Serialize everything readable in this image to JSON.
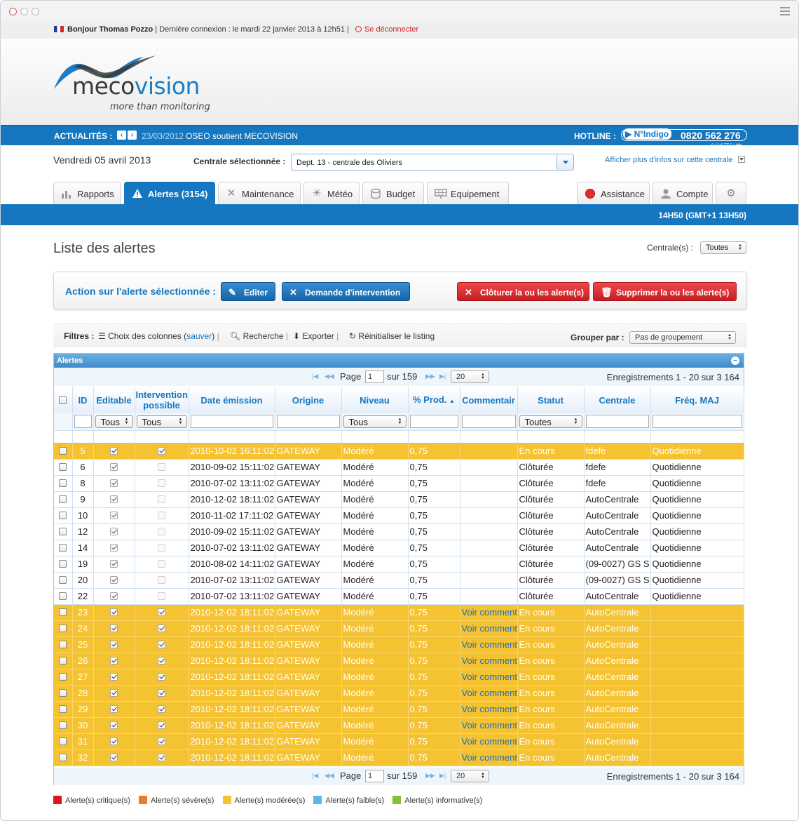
{
  "welcome": {
    "greeting": "Bonjour Thomas Pozzo",
    "last_login": " | Dernière connexion : le mardi 22 janvier 2013 à 12h51 | ",
    "logout": "Se déconnecter"
  },
  "brand": {
    "name_start": "meco",
    "name_end": "vision",
    "tagline": "more than monitoring"
  },
  "news": {
    "label": "ACTUALITÉS :",
    "date": "23/03/2012",
    "text": "OSEO soutient MECOVISION",
    "hotline_label": "HOTLINE :",
    "indigo_label": "N°Indigo",
    "indigo_number": "0820 562 276",
    "indigo_rate": "0,12 € TTC / MN"
  },
  "header": {
    "date": "Vendredi 05 avril 2013",
    "central_label": "Centrale sélectionnée :",
    "central_value": "Dept. 13 - centrale des Oliviers",
    "more_info": "Afficher plus d'infos sur cette centrale"
  },
  "tabs": [
    {
      "label": "Rapports",
      "icon": "bar-chart-icon"
    },
    {
      "label": "Alertes (3154)",
      "icon": "warning-icon"
    },
    {
      "label": "Maintenance",
      "icon": "wrench-icon"
    },
    {
      "label": "Météo",
      "icon": "sun-icon"
    },
    {
      "label": "Budget",
      "icon": "coins-icon"
    },
    {
      "label": "Equipement",
      "icon": "panel-icon"
    },
    {
      "label": "Assistance",
      "icon": "lifebuoy-icon"
    },
    {
      "label": "Compte",
      "icon": "user-icon"
    },
    {
      "label": "",
      "icon": "gear-icon"
    }
  ],
  "clock": "14H50 (GMT+1 13H50)",
  "page": {
    "title": "Liste des alertes",
    "central_filter_label": "Centrale(s) :",
    "central_filter_value": "Toutes"
  },
  "actions": {
    "label": "Action sur l'alerte sélectionnée :",
    "edit": "Editer",
    "intervention": "Demande d'intervention",
    "close": "Clôturer la ou les alerte(s)",
    "delete": "Supprimer la ou les alerte(s)"
  },
  "filters": {
    "label": "Filtres :",
    "columns": "Choix des colonnes",
    "save": "sauver",
    "search": "Recherche",
    "export": "Exporter",
    "reset": "Réinitialiser le listing",
    "group_label": "Grouper par :",
    "group_value": "Pas de groupement"
  },
  "grid": {
    "title": "Alertes",
    "page_label": "Page",
    "page_value": "1",
    "of_label": "sur 159",
    "page_size": "20",
    "records": "Enregistrements 1 - 20 sur 3 164",
    "columns": [
      "ID",
      "Editable",
      "Intervention possible",
      "Date émission",
      "Origine",
      "Niveau",
      "% Prod.",
      "Commentair",
      "Statut",
      "Centrale",
      "Fréq. MAJ"
    ],
    "filter_values": {
      "editable": "Tous",
      "intervention": "Tous",
      "niveau": "Tous",
      "statut": "Toutes"
    },
    "rows": [
      {
        "id": "5",
        "ed": true,
        "iv": true,
        "date": "2010-10-02 16:11:02",
        "origine": "GATEWAY",
        "niveau": "Modéré",
        "prod": "0,75",
        "comment": "",
        "statut": "En cours",
        "centrale": "fdefe",
        "freq": "Quotidienne",
        "hl": true
      },
      {
        "id": "6",
        "ed": true,
        "iv": false,
        "date": "2010-09-02 15:11:02",
        "origine": "GATEWAY",
        "niveau": "Modéré",
        "prod": "0,75",
        "comment": "",
        "statut": "Clôturée",
        "centrale": "fdefe",
        "freq": "Quotidienne",
        "hl": false
      },
      {
        "id": "8",
        "ed": true,
        "iv": false,
        "date": "2010-07-02 13:11:02",
        "origine": "GATEWAY",
        "niveau": "Modéré",
        "prod": "0,75",
        "comment": "",
        "statut": "Clôturée",
        "centrale": "fdefe",
        "freq": "Quotidienne",
        "hl": false
      },
      {
        "id": "9",
        "ed": true,
        "iv": false,
        "date": "2010-12-02 18:11:02",
        "origine": "GATEWAY",
        "niveau": "Modéré",
        "prod": "0,75",
        "comment": "",
        "statut": "Clôturée",
        "centrale": "AutoCentrale",
        "freq": "Quotidienne",
        "hl": false
      },
      {
        "id": "10",
        "ed": true,
        "iv": false,
        "date": "2010-11-02 17:11:02",
        "origine": "GATEWAY",
        "niveau": "Modéré",
        "prod": "0,75",
        "comment": "",
        "statut": "Clôturée",
        "centrale": "AutoCentrale",
        "freq": "Quotidienne",
        "hl": false
      },
      {
        "id": "12",
        "ed": true,
        "iv": false,
        "date": "2010-09-02 15:11:02",
        "origine": "GATEWAY",
        "niveau": "Modéré",
        "prod": "0,75",
        "comment": "",
        "statut": "Clôturée",
        "centrale": "AutoCentrale",
        "freq": "Quotidienne",
        "hl": false
      },
      {
        "id": "14",
        "ed": true,
        "iv": false,
        "date": "2010-07-02 13:11:02",
        "origine": "GATEWAY",
        "niveau": "Modéré",
        "prod": "0,75",
        "comment": "",
        "statut": "Clôturée",
        "centrale": "AutoCentrale",
        "freq": "Quotidienne",
        "hl": false
      },
      {
        "id": "19",
        "ed": true,
        "iv": false,
        "date": "2010-08-02 14:11:02",
        "origine": "GATEWAY",
        "niveau": "Modéré",
        "prod": "0,75",
        "comment": "",
        "statut": "Clôturée",
        "centrale": "(09-0027) GS S",
        "freq": "Quotidienne",
        "hl": false
      },
      {
        "id": "20",
        "ed": true,
        "iv": false,
        "date": "2010-07-02 13:11:02",
        "origine": "GATEWAY",
        "niveau": "Modéré",
        "prod": "0,75",
        "comment": "",
        "statut": "Clôturée",
        "centrale": "(09-0027) GS S",
        "freq": "Quotidienne",
        "hl": false
      },
      {
        "id": "22",
        "ed": true,
        "iv": false,
        "date": "2010-07-02 13:11:02",
        "origine": "GATEWAY",
        "niveau": "Modéré",
        "prod": "0,75",
        "comment": "",
        "statut": "Clôturée",
        "centrale": "AutoCentrale",
        "freq": "Quotidienne",
        "hl": false
      },
      {
        "id": "23",
        "ed": true,
        "iv": true,
        "date": "2010-12-02 18:11:02",
        "origine": "GATEWAY",
        "niveau": "Modéré",
        "prod": "0,75",
        "comment": "Voir comment",
        "statut": "En cours",
        "centrale": "AutoCentrale",
        "freq": "",
        "hl": true
      },
      {
        "id": "24",
        "ed": true,
        "iv": true,
        "date": "2010-12-02 18:11:02",
        "origine": "GATEWAY",
        "niveau": "Modéré",
        "prod": "0,75",
        "comment": "Voir comment",
        "statut": "En cours",
        "centrale": "AutoCentrale",
        "freq": "",
        "hl": true
      },
      {
        "id": "25",
        "ed": true,
        "iv": true,
        "date": "2010-12-02 18:11:02",
        "origine": "GATEWAY",
        "niveau": "Modéré",
        "prod": "0,75",
        "comment": "Voir comment",
        "statut": "En cours",
        "centrale": "AutoCentrale",
        "freq": "",
        "hl": true
      },
      {
        "id": "26",
        "ed": true,
        "iv": true,
        "date": "2010-12-02 18:11:02",
        "origine": "GATEWAY",
        "niveau": "Modéré",
        "prod": "0,75",
        "comment": "Voir comment",
        "statut": "En cours",
        "centrale": "AutoCentrale",
        "freq": "",
        "hl": true
      },
      {
        "id": "27",
        "ed": true,
        "iv": true,
        "date": "2010-12-02 18:11:02",
        "origine": "GATEWAY",
        "niveau": "Modéré",
        "prod": "0,75",
        "comment": "Voir comment",
        "statut": "En cours",
        "centrale": "AutoCentrale",
        "freq": "",
        "hl": true
      },
      {
        "id": "28",
        "ed": true,
        "iv": true,
        "date": "2010-12-02 18:11:02",
        "origine": "GATEWAY",
        "niveau": "Modéré",
        "prod": "0,75",
        "comment": "Voir comment",
        "statut": "En cours",
        "centrale": "AutoCentrale",
        "freq": "",
        "hl": true
      },
      {
        "id": "29",
        "ed": true,
        "iv": true,
        "date": "2010-12-02 18:11:02",
        "origine": "GATEWAY",
        "niveau": "Modéré",
        "prod": "0,75",
        "comment": "Voir comment",
        "statut": "En cours",
        "centrale": "AutoCentrale",
        "freq": "",
        "hl": true
      },
      {
        "id": "30",
        "ed": true,
        "iv": true,
        "date": "2010-12-02 18:11:02",
        "origine": "GATEWAY",
        "niveau": "Modéré",
        "prod": "0,75",
        "comment": "Voir comment",
        "statut": "En cours",
        "centrale": "AutoCentrale",
        "freq": "",
        "hl": true
      },
      {
        "id": "31",
        "ed": true,
        "iv": true,
        "date": "2010-12-02 18:11:02",
        "origine": "GATEWAY",
        "niveau": "Modéré",
        "prod": "0,75",
        "comment": "Voir comment",
        "statut": "En cours",
        "centrale": "AutoCentrale",
        "freq": "",
        "hl": true
      },
      {
        "id": "32",
        "ed": true,
        "iv": true,
        "date": "2010-12-02 18:11:02",
        "origine": "GATEWAY",
        "niveau": "Modéré",
        "prod": "0,75",
        "comment": "Voir comment",
        "statut": "En cours",
        "centrale": "AutoCentrale",
        "freq": "",
        "hl": true
      }
    ]
  },
  "legend": [
    {
      "label": "Alerte(s) critique(s)",
      "color": "#e0141b"
    },
    {
      "label": "Alerte(s) sévère(s)",
      "color": "#f07a24"
    },
    {
      "label": "Alerte(s) modérée(s)",
      "color": "#f5c231"
    },
    {
      "label": "Alerte(s) faible(s)",
      "color": "#5cb7e6"
    },
    {
      "label": "Alerte(s) informative(s)",
      "color": "#82c23a"
    }
  ],
  "colors": {
    "brand_blue": "#1577c0",
    "highlight_row": "#f5c231",
    "danger_red": "#d42020"
  }
}
